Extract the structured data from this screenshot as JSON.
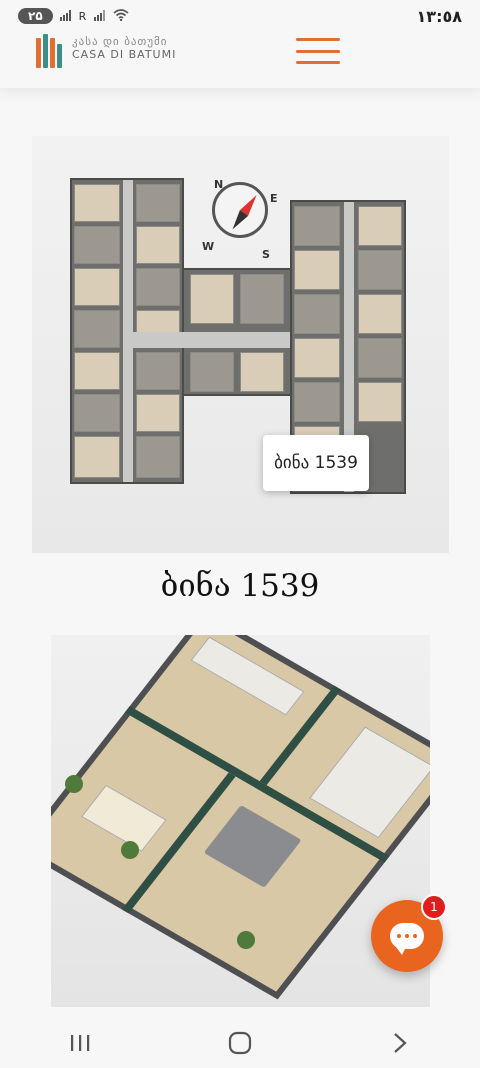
{
  "status_bar": {
    "battery_level": "۲۵",
    "signal_label": "R",
    "clock": "١٣:٥٨"
  },
  "header": {
    "logo_top_text": "კასა დი ბათუმი",
    "logo_bottom_text": "CASA DI BATUMI",
    "menu_icon": "hamburger-menu-icon",
    "accent_color": "#e07030"
  },
  "floorplan": {
    "apartment_tag": "ბინა 1539",
    "compass_letters": {
      "n": "N",
      "e": "E",
      "s": "S",
      "w": "W"
    }
  },
  "apartment": {
    "title": "ბინა 1539"
  },
  "chat": {
    "badge_count": "1",
    "icon": "chat-bubble-icon",
    "color": "#e8641f"
  },
  "navbar": {
    "recent_icon": "recent-apps-icon",
    "home_icon": "home-circle-icon",
    "back_icon": "back-chevron-icon"
  }
}
